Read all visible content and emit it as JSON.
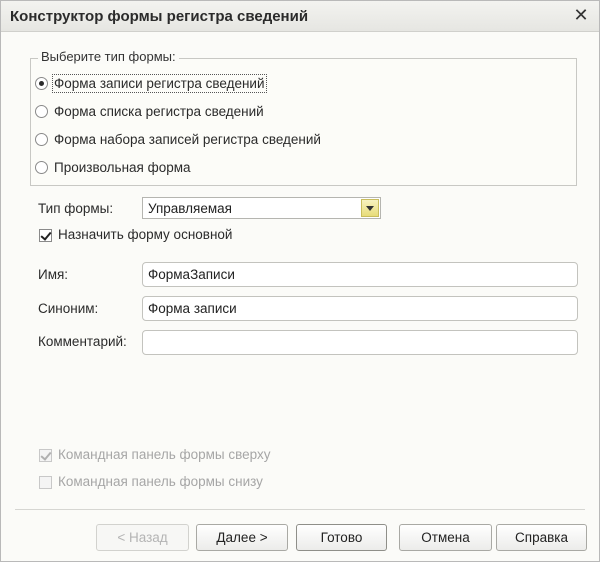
{
  "window": {
    "title": "Конструктор формы регистра сведений",
    "close_glyph": "✕"
  },
  "form_type_group": {
    "legend": "Выберите тип формы:",
    "options": [
      {
        "label": "Форма записи регистра сведений",
        "selected": true
      },
      {
        "label": "Форма списка регистра сведений",
        "selected": false
      },
      {
        "label": "Форма набора записей регистра сведений",
        "selected": false
      },
      {
        "label": "Произвольная форма",
        "selected": false
      }
    ]
  },
  "form_kind": {
    "label": "Тип формы:",
    "value": "Управляемая"
  },
  "set_main": {
    "label": "Назначить форму основной",
    "checked": true
  },
  "fields": {
    "name": {
      "label": "Имя:",
      "value": "ФормаЗаписи"
    },
    "synonym": {
      "label": "Синоним:",
      "value": "Форма записи"
    },
    "comment": {
      "label": "Комментарий:",
      "value": ""
    }
  },
  "command_panel": {
    "top": {
      "label": "Командная панель формы сверху",
      "checked": true,
      "enabled": false
    },
    "bottom": {
      "label": "Командная панель формы снизу",
      "checked": false,
      "enabled": false
    }
  },
  "buttons": {
    "back": "< Назад",
    "next": "Далее >",
    "done": "Готово",
    "cancel": "Отмена",
    "help": "Справка"
  }
}
